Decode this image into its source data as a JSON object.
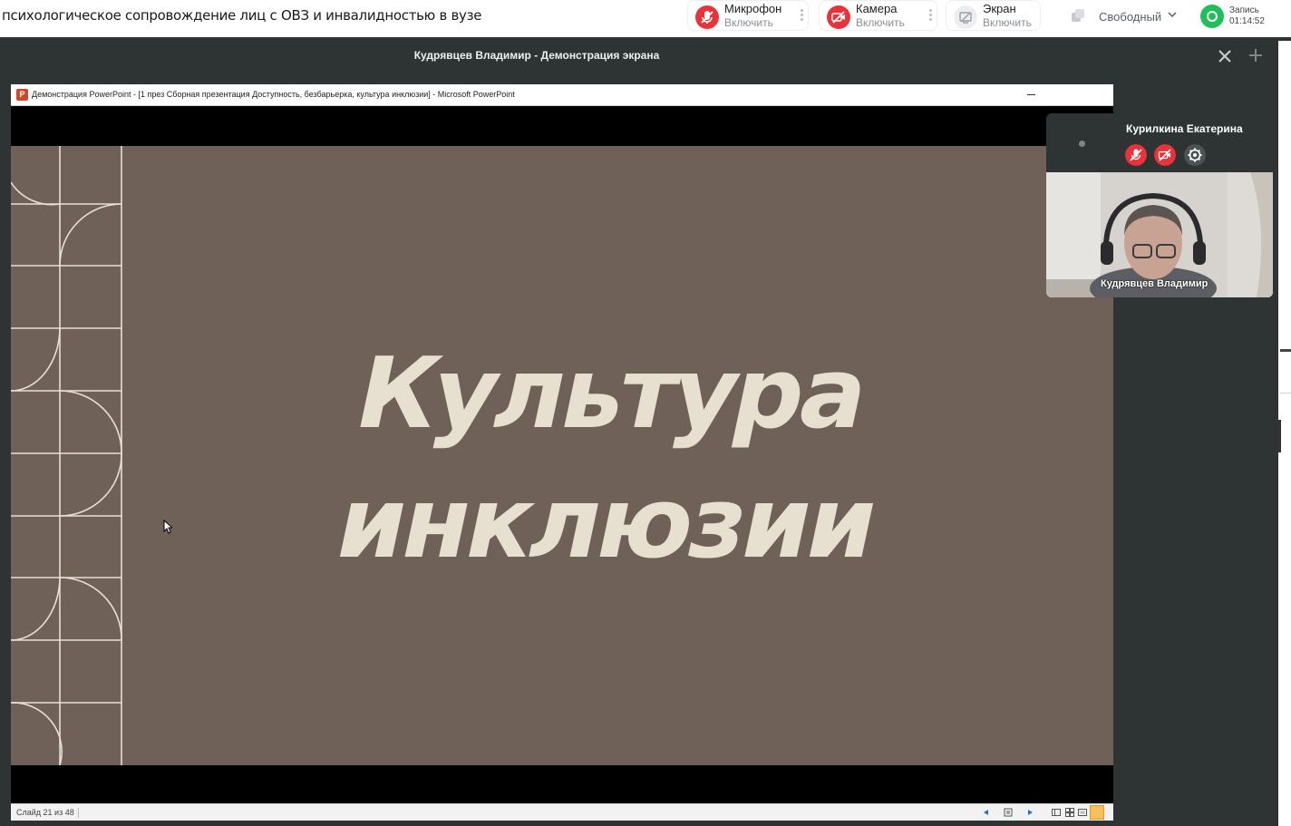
{
  "meeting": {
    "title": "психологическое сопровождение лиц с ОВЗ и инвалидностью в вузе"
  },
  "controls": {
    "mic": {
      "label": "Микрофон",
      "sub": "Включить",
      "icon": "mic-off-icon",
      "color": "#e8333b"
    },
    "camera": {
      "label": "Камера",
      "sub": "Включить",
      "icon": "camera-off-icon",
      "color": "#e8333b"
    },
    "screen": {
      "label": "Экран",
      "sub": "Включить",
      "icon": "screen-share-icon",
      "color": "#e3e5e8"
    }
  },
  "status": {
    "selected": "Свободный"
  },
  "recording": {
    "label": "Запись",
    "time": "01:14:52",
    "color": "#1fbf5a"
  },
  "share": {
    "title": "Кудрявцев Владимир - Демонстрация экрана"
  },
  "powerpoint": {
    "window_title": "Демонстрация PowerPoint - [1 през Сборная презентация Доступность, безбарьерка, культура инклюзии] - Microsoft PowerPoint",
    "app_icon_letter": "P",
    "slide_counter": "Слайд 21 из 48",
    "slide": {
      "title_line1": "Культура",
      "title_line2": "инклюзии",
      "background": "#6f6158",
      "text_color": "#e7dfd0"
    }
  },
  "participants": {
    "self_name": "Курилкина Екатерина",
    "speaker_name": "Кудрявцев Владимир"
  }
}
